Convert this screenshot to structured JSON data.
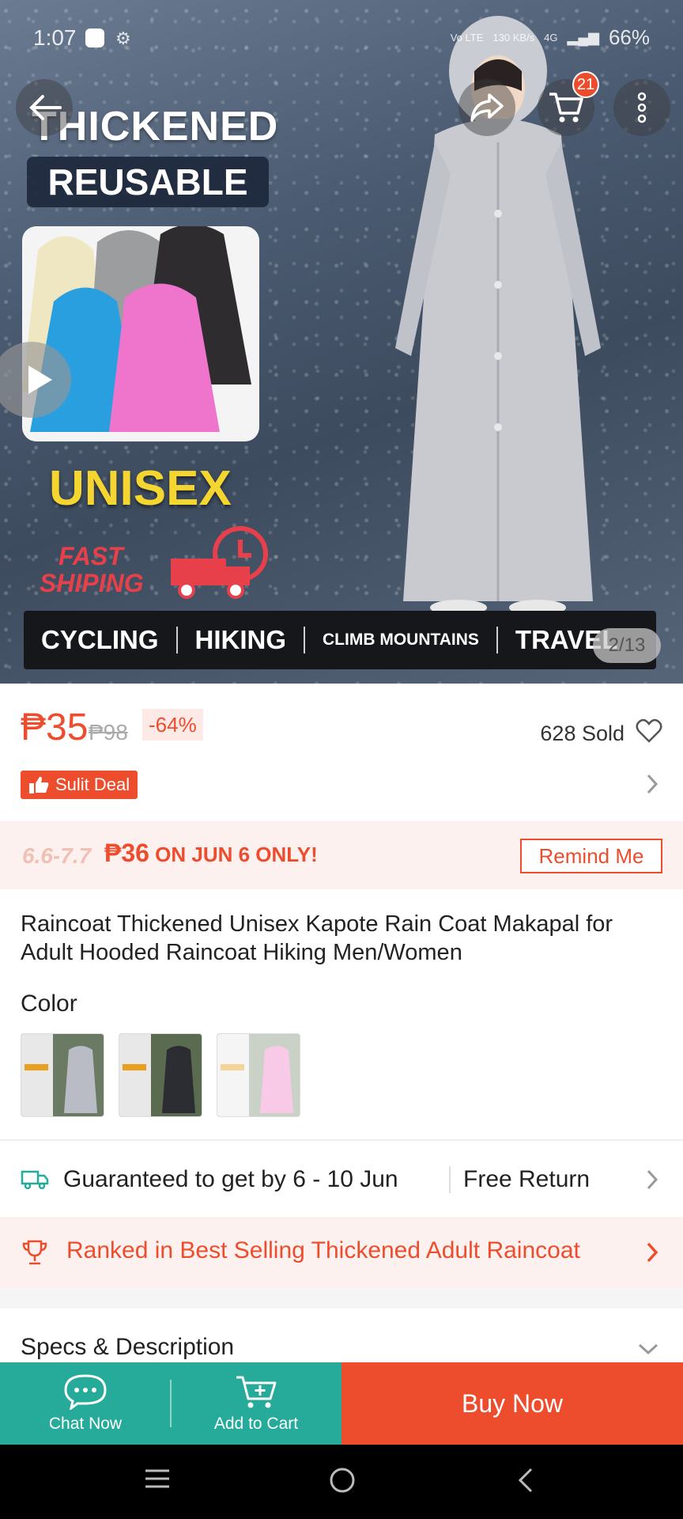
{
  "status_bar": {
    "time": "1:07",
    "network": "Vo LTE",
    "speed": "130 KB/s",
    "signal": "4G",
    "battery": "66%"
  },
  "hero": {
    "headline_1": "THICKENED",
    "headline_2": "REUSABLE",
    "badge_unisex": "UNISEX",
    "fast_shipping_1": "FAST",
    "fast_shipping_2": "SHIPING",
    "activities": [
      "CYCLING",
      "HIKING",
      "CLIMB MOUNTAINS",
      "TRAVEL"
    ],
    "image_counter": "2/13",
    "cart_count": "21"
  },
  "price": {
    "current": "₱35",
    "original": "₱98",
    "discount": "-64%",
    "sold": "628 Sold",
    "deal_label": "Sulit Deal"
  },
  "promo": {
    "date_range": "6.6-7.7",
    "price": "₱36",
    "text": " ON JUN 6 ONLY!",
    "remind_button": "Remind Me"
  },
  "product": {
    "title": "Raincoat Thickened Unisex Kapote Rain Coat Makapal for Adult Hooded Raincoat Hiking Men/Women",
    "color_label": "Color",
    "color_options": [
      "GRAY",
      "BLACK",
      "PINK"
    ]
  },
  "shipping": {
    "guarantee": "Guaranteed to get by 6 - 10 Jun",
    "free_return": "Free Return"
  },
  "ranked": {
    "text": "Ranked in Best Selling Thickened Adult Raincoat"
  },
  "specs": {
    "title": "Specs & Description"
  },
  "bottom_bar": {
    "chat": "Chat Now",
    "add_to_cart": "Add to Cart",
    "buy_now": "Buy Now"
  },
  "colors": {
    "accent": "#ee4d2d",
    "teal": "#26aa99"
  }
}
